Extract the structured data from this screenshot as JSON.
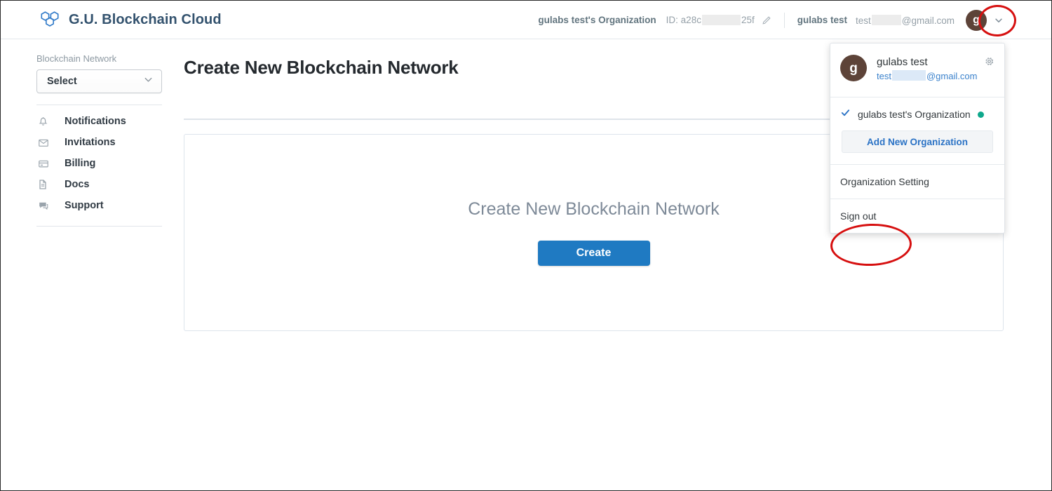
{
  "header": {
    "brand": "G.U. Blockchain Cloud",
    "brand_icon": "hexagon-cluster-logo",
    "org_name": "gulabs test's Organization",
    "org_id_prefix": "ID: a28c",
    "org_id_suffix": "25f",
    "edit_icon": "pencil-icon",
    "user_name": "gulabs test",
    "user_email_prefix": "test",
    "user_email_suffix": "@gmail.com",
    "avatar_initial": "g",
    "caret_icon": "chevron-down-icon"
  },
  "sidebar": {
    "section_label": "Blockchain Network",
    "select_value": "Select",
    "select_caret_icon": "chevron-down-icon",
    "items": [
      {
        "label": "Notifications",
        "icon": "bell-icon"
      },
      {
        "label": "Invitations",
        "icon": "envelope-icon"
      },
      {
        "label": "Billing",
        "icon": "credit-card-icon"
      },
      {
        "label": "Docs",
        "icon": "document-icon"
      },
      {
        "label": "Support",
        "icon": "chat-bubble-icon"
      }
    ]
  },
  "main": {
    "page_title": "Create New Blockchain Network",
    "card_heading": "Create New Blockchain Network",
    "create_button": "Create"
  },
  "dropdown": {
    "avatar_initial": "g",
    "user_name": "gulabs test",
    "email_prefix": "test",
    "email_suffix": "@gmail.com",
    "settings_icon": "gear-icon",
    "check_icon": "check-icon",
    "org_name": "gulabs test's Organization",
    "org_status": "active",
    "add_org_label": "Add New Organization",
    "menu": [
      {
        "label": "Organization Setting"
      },
      {
        "label": "Sign out"
      }
    ]
  },
  "colors": {
    "brand_blue": "#33526e",
    "logo_blue": "#2d78c8",
    "primary_button": "#1f7ac2",
    "link_blue": "#3b82cc",
    "status_teal": "#0fa88c",
    "annotation_red": "#d60f0f",
    "avatar_brown": "#5d4338"
  }
}
